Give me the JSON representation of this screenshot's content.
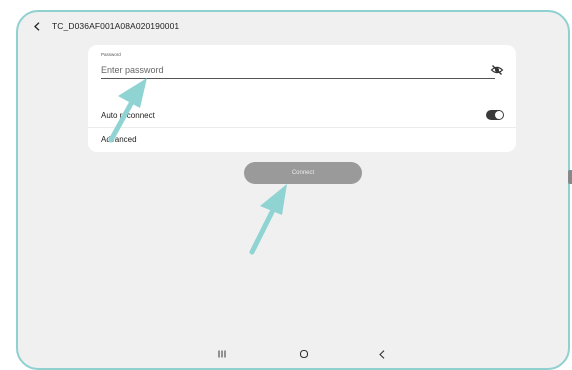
{
  "header": {
    "title": "TC_D036AF001A08A020190001"
  },
  "password": {
    "label": "Password",
    "placeholder": "Enter password"
  },
  "auto_reconnect": {
    "label": "Auto reconnect",
    "enabled": true
  },
  "advanced": {
    "label": "Advanced"
  },
  "connect": {
    "label": "Connect"
  },
  "icons": {
    "back": "chevron-left-icon",
    "eye": "eye-off-icon",
    "recents": "recents-icon",
    "home": "home-icon",
    "nav_back": "nav-back-icon"
  },
  "colors": {
    "accent_arrow": "#8fd3d3",
    "toggle_on": "#3a3a3a",
    "connect_disabled": "#9a9a9a",
    "background": "#f0f0f0"
  }
}
